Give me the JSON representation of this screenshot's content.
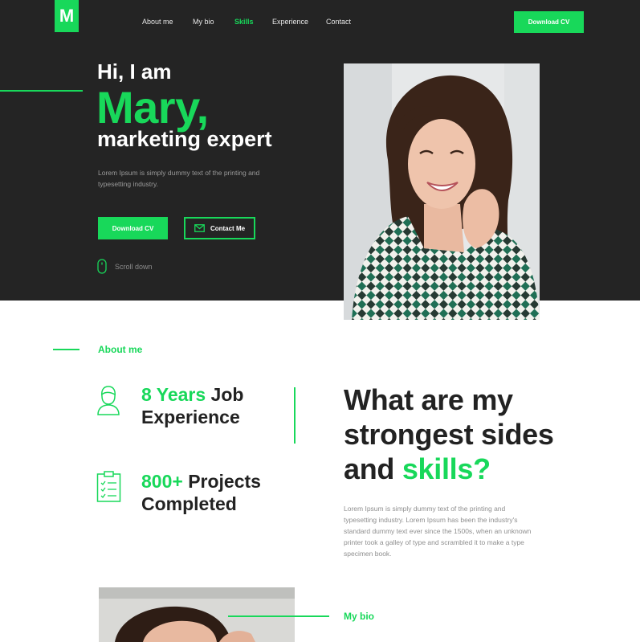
{
  "brand": {
    "logo_letter": "M",
    "accent": "#18d85a",
    "dark_bg": "#242424"
  },
  "nav": {
    "items": [
      {
        "label": "About me",
        "active": false
      },
      {
        "label": "My bio",
        "active": false
      },
      {
        "label": "Skills",
        "active": true
      },
      {
        "label": "Experience",
        "active": false
      },
      {
        "label": "Contact",
        "active": false
      }
    ],
    "cta_label": "Download CV"
  },
  "hero": {
    "greeting": "Hi, I am",
    "name": "Mary,",
    "role": "marketing expert",
    "description": "Lorem Ipsum is simply dummy text of the printing and typesetting industry.",
    "primary_button": "Download CV",
    "secondary_button": "Contact Me",
    "secondary_icon": "envelope-icon",
    "scroll_label": "Scroll down",
    "scroll_icon": "mouse-icon"
  },
  "about": {
    "section_label": "About me",
    "stats": [
      {
        "highlight": "8 Years",
        "rest": " Job",
        "line2": "Experience",
        "icon": "person-icon"
      },
      {
        "highlight": "800+",
        "rest": " Projects",
        "line2": "Completed",
        "icon": "clipboard-icon"
      }
    ],
    "heading_line1": "What are my",
    "heading_line2": "strongest sides",
    "heading_line3_prefix": "and ",
    "heading_line3_highlight": "skills?",
    "paragraph": "Lorem Ipsum is simply dummy text of the printing and typesetting industry. Lorem Ipsum has been the industry's standard dummy text ever since the 1500s, when an unknown printer took a galley of type and scrambled it to make a type specimen book."
  },
  "bio": {
    "section_label": "My bio"
  }
}
